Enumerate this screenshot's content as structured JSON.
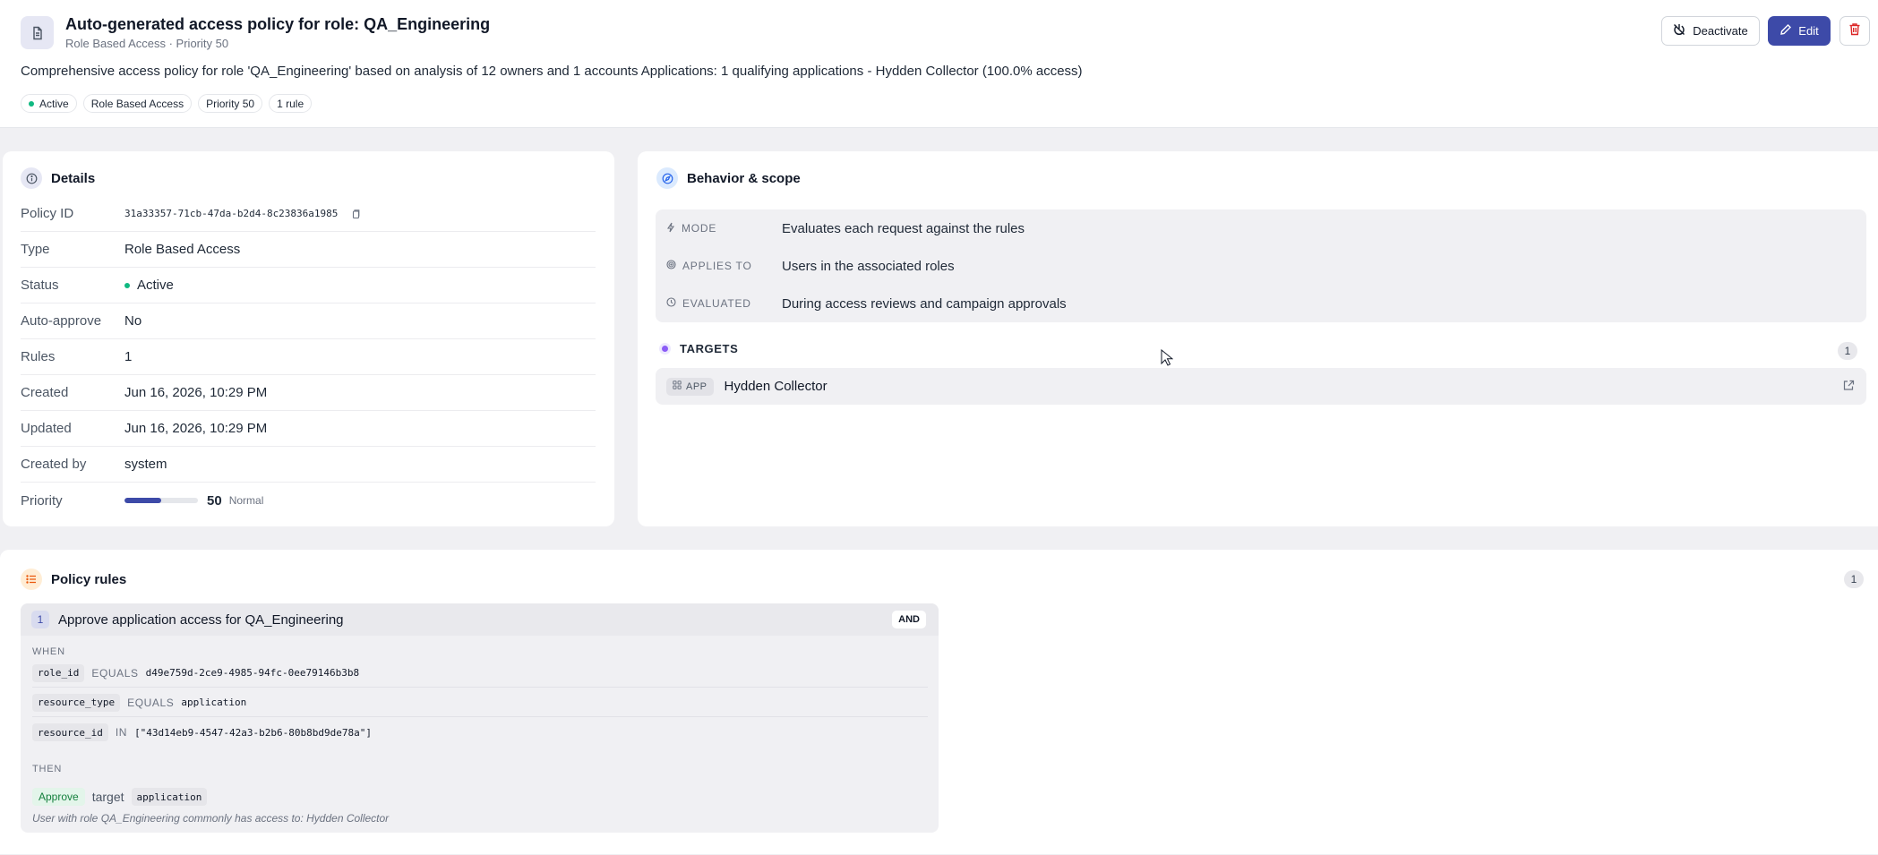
{
  "header": {
    "title": "Auto-generated access policy for role: QA_Engineering",
    "subtitle": "Role Based Access · Priority 50",
    "description": "Comprehensive access policy for role 'QA_Engineering' based on analysis of 12 owners and 1 accounts Applications: 1 qualifying applications - Hydden Collector (100.0% access)",
    "badges": {
      "status": "Active",
      "type": "Role Based Access",
      "priority": "Priority 50",
      "rules": "1 rule"
    },
    "actions": {
      "deactivate": "Deactivate",
      "edit": "Edit"
    }
  },
  "details": {
    "title": "Details",
    "rows": [
      {
        "label": "Policy ID",
        "value": "31a33357-71cb-47da-b2d4-8c23836a1985"
      },
      {
        "label": "Type",
        "value": "Role Based Access"
      },
      {
        "label": "Status",
        "value": "Active"
      },
      {
        "label": "Auto-approve",
        "value": "No"
      },
      {
        "label": "Rules",
        "value": "1"
      },
      {
        "label": "Created",
        "value": "Jun 16, 2026, 10:29 PM"
      },
      {
        "label": "Updated",
        "value": "Jun 16, 2026, 10:29 PM"
      },
      {
        "label": "Created by",
        "value": "system"
      },
      {
        "label": "Priority",
        "value": "50",
        "level": "Normal",
        "fill_percent": 50
      }
    ]
  },
  "behavior": {
    "title": "Behavior & scope",
    "rows": [
      {
        "key": "MODE",
        "value": "Evaluates each request against the rules"
      },
      {
        "key": "APPLIES TO",
        "value": "Users in the associated roles"
      },
      {
        "key": "EVALUATED",
        "value": "During access reviews and campaign approvals"
      }
    ],
    "targets": {
      "label": "TARGETS",
      "count": "1",
      "items": [
        {
          "tag": "APP",
          "name": "Hydden Collector"
        }
      ]
    }
  },
  "rules": {
    "title": "Policy rules",
    "count": "1",
    "items": [
      {
        "number": "1",
        "title": "Approve application access for QA_Engineering",
        "combinator": "AND",
        "when_label": "WHEN",
        "conditions": [
          {
            "field": "role_id",
            "operator": "EQUALS",
            "value": "d49e759d-2ce9-4985-94fc-0ee79146b3b8"
          },
          {
            "field": "resource_type",
            "operator": "EQUALS",
            "value": "application"
          },
          {
            "field": "resource_id",
            "operator": "IN",
            "value": "[\"43d14eb9-4547-42a3-b2b6-80b8bd9de78a\"]"
          }
        ],
        "then_label": "THEN",
        "action": "Approve",
        "target_word": "target",
        "target_value": "application",
        "note": "User with role QA_Engineering commonly has access to: Hydden Collector"
      }
    ]
  },
  "colors": {
    "primary": "#3d4aa8",
    "active_dot": "#10b981",
    "approve_text": "#15803d",
    "delete_red": "#dc2626"
  }
}
